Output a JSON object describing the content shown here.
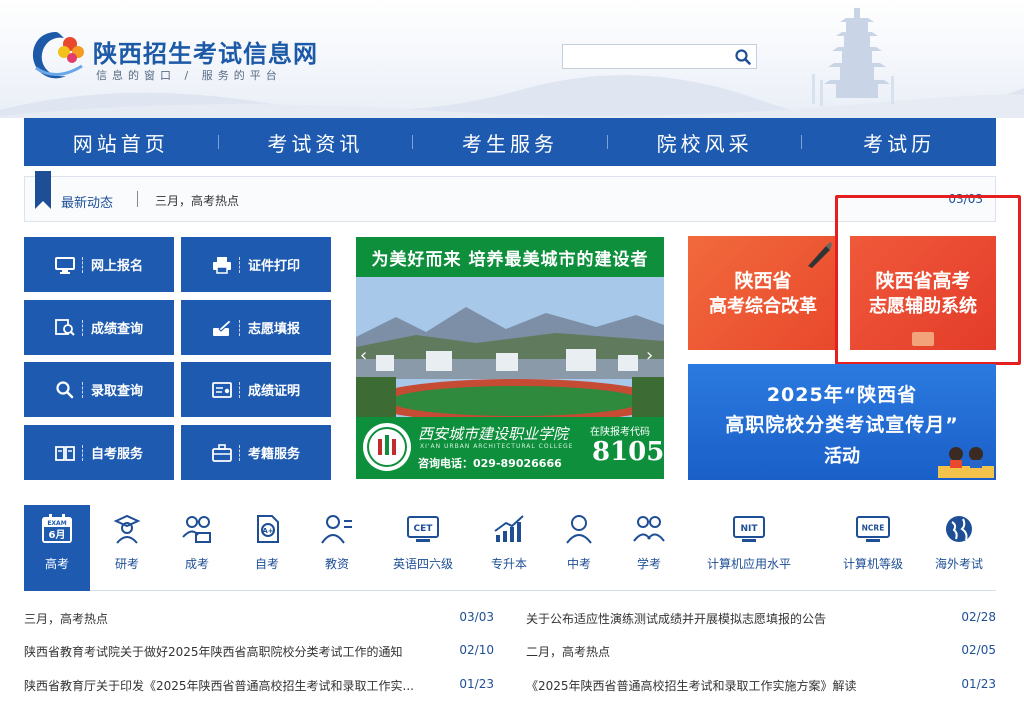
{
  "header": {
    "site_title": "陕西招生考试信息网",
    "slogan": "信息的窗口 / 服务的平台",
    "search": {
      "placeholder": "",
      "value": ""
    }
  },
  "nav": {
    "items": [
      "网站首页",
      "考试资讯",
      "考生服务",
      "院校风采",
      "考试历"
    ]
  },
  "ticker": {
    "label": "最新动态",
    "text": "三月，高考热点",
    "date": "03/03"
  },
  "services": [
    {
      "label": "网上报名",
      "icon": "monitor-icon"
    },
    {
      "label": "证件打印",
      "icon": "printer-icon"
    },
    {
      "label": "成绩查询",
      "icon": "score-search-icon"
    },
    {
      "label": "志愿填报",
      "icon": "form-fill-icon"
    },
    {
      "label": "录取查询",
      "icon": "search-icon"
    },
    {
      "label": "成绩证明",
      "icon": "certificate-icon"
    },
    {
      "label": "自考服务",
      "icon": "book-icon"
    },
    {
      "label": "考籍服务",
      "icon": "briefcase-icon"
    }
  ],
  "banner": {
    "title": "为美好而来 培养最美城市的建设者",
    "college_name": "西安城市建设职业学院",
    "college_en": "XI'AN URBAN ARCHITECTURAL COLLEGE",
    "phone": "咨询电话：029-89026666",
    "code_label": "在陕报考代码",
    "code": "8105"
  },
  "promos": {
    "reform": {
      "line1": "陕西省",
      "line2": "高考综合改革"
    },
    "volunteer": {
      "line1": "陕西省高考",
      "line2": "志愿辅助系统"
    },
    "month": {
      "line1": "2025年“陕西省",
      "line2": "高职院校分类考试宣传月”",
      "line3": "活动"
    }
  },
  "exam_categories": [
    {
      "label": "高考",
      "icon": "exam-calendar-icon",
      "badge_top": "EXAM",
      "badge_bottom": "6月",
      "active": true
    },
    {
      "label": "研考",
      "icon": "graduate-icon"
    },
    {
      "label": "成考",
      "icon": "adults-icon"
    },
    {
      "label": "自考",
      "icon": "self-study-icon"
    },
    {
      "label": "教资",
      "icon": "teacher-icon"
    },
    {
      "label": "英语四六级",
      "icon": "cet-icon",
      "badge": "CET"
    },
    {
      "label": "专升本",
      "icon": "growth-chart-icon"
    },
    {
      "label": "中考",
      "icon": "student-icon"
    },
    {
      "label": "学考",
      "icon": "academic-test-icon"
    },
    {
      "label": "计算机应用水平",
      "icon": "nit-icon",
      "badge": "NIT"
    },
    {
      "label": "计算机等级",
      "icon": "ncre-icon",
      "badge": "NCRE"
    },
    {
      "label": "海外考试",
      "icon": "globe-icon"
    }
  ],
  "news_left": [
    {
      "title": "三月，高考热点",
      "date": "03/03"
    },
    {
      "title": "陕西省教育考试院关于做好2025年陕西省高职院校分类考试工作的通知",
      "date": "02/10"
    },
    {
      "title": "陕西省教育厅关于印发《2025年陕西省普通高校招生考试和录取工作实...",
      "date": "01/23"
    }
  ],
  "news_right": [
    {
      "title": "关于公布适应性演练测试成绩并开展模拟志愿填报的公告",
      "date": "02/28"
    },
    {
      "title": "二月，高考热点",
      "date": "02/05"
    },
    {
      "title": "《2025年陕西省普通高校招生考试和录取工作实施方案》解读",
      "date": "01/23"
    }
  ],
  "colors": {
    "primary_blue": "#1e5bb0",
    "banner_green": "#0d8f3c",
    "promo_red": "#e8482b",
    "highlight_red": "#e51f1f"
  }
}
